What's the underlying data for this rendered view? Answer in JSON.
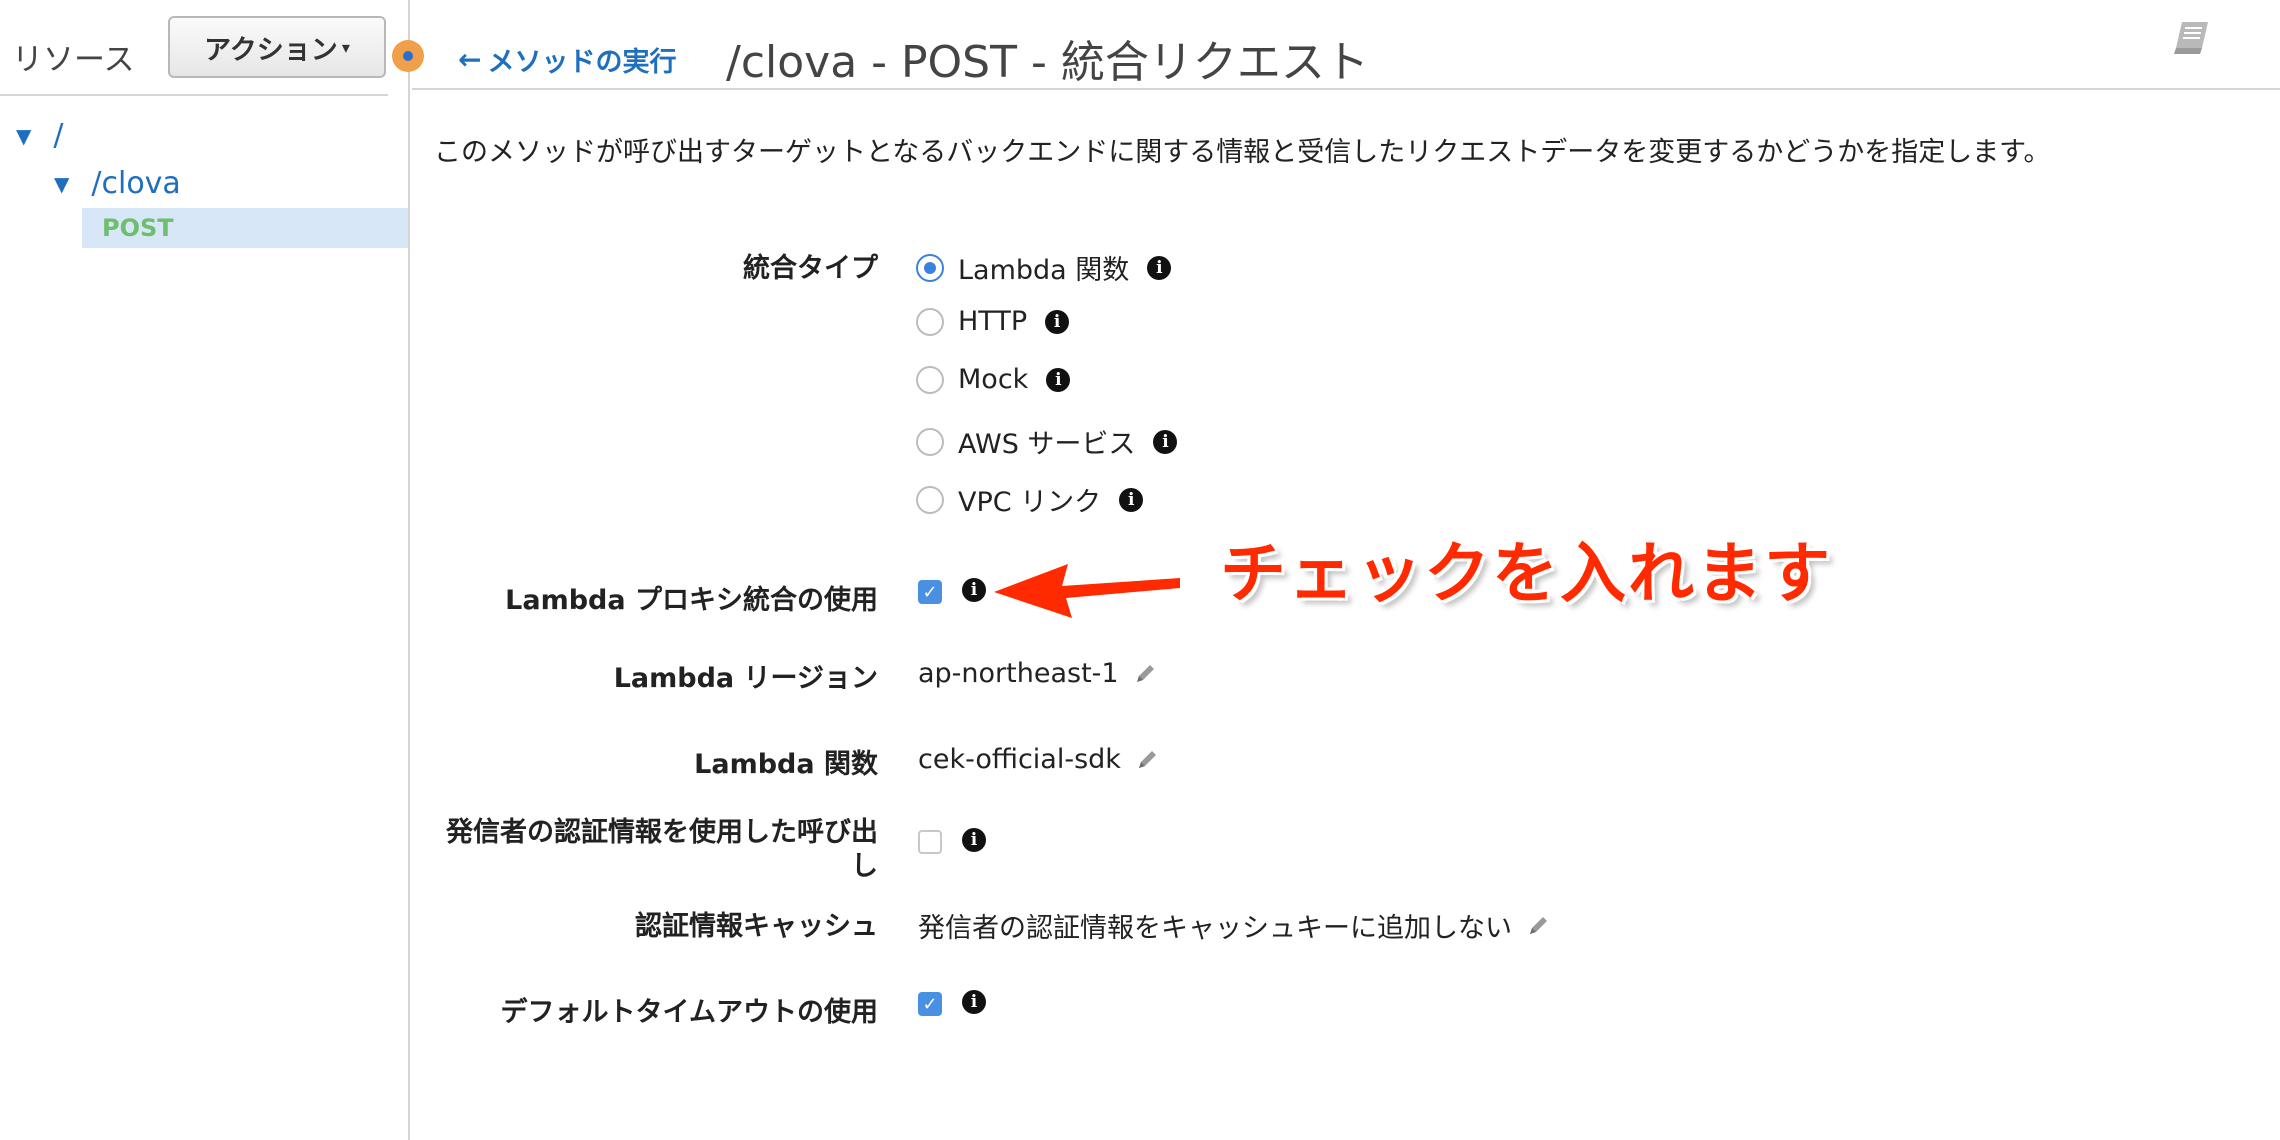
{
  "sidebar": {
    "title": "リソース",
    "actions_label": "アクション",
    "tree": [
      {
        "label": "/"
      },
      {
        "label": "/clova"
      }
    ],
    "selected_method": "POST"
  },
  "header": {
    "back_label": "メソッドの実行",
    "title": "/clova - POST - 統合リクエスト"
  },
  "description": "このメソッドが呼び出すターゲットとなるバックエンドに関する情報と受信したリクエストデータを変更するかどうかを指定します。",
  "form": {
    "integration_type_label": "統合タイプ",
    "integration_types": [
      {
        "label": "Lambda 関数",
        "checked": true
      },
      {
        "label": "HTTP",
        "checked": false
      },
      {
        "label": "Mock",
        "checked": false
      },
      {
        "label": "AWS サービス",
        "checked": false
      },
      {
        "label": "VPC リンク",
        "checked": false
      }
    ],
    "lambda_proxy_label": "Lambda プロキシ統合の使用",
    "lambda_proxy_checked": true,
    "lambda_region_label": "Lambda リージョン",
    "lambda_region_value": "ap-northeast-1",
    "lambda_function_label": "Lambda 関数",
    "lambda_function_value": "cek-official-sdk",
    "invoke_with_caller_label_line1": "発信者の認証情報を使用した呼び出",
    "invoke_with_caller_label_line2": "し",
    "invoke_with_caller_checked": false,
    "credentials_cache_label": "認証情報キャッシュ",
    "credentials_cache_value": "発信者の認証情報をキャッシュキーに追加しない",
    "default_timeout_label": "デフォルトタイムアウトの使用",
    "default_timeout_checked": true
  },
  "annotation": {
    "text": "チェックを入れます",
    "color": "#ff2a00"
  },
  "colors": {
    "link": "#1f6fbf",
    "method_green": "#6dbf6d",
    "selected_bg": "#d7e7f7",
    "checkbox_blue": "#4a90e2"
  }
}
